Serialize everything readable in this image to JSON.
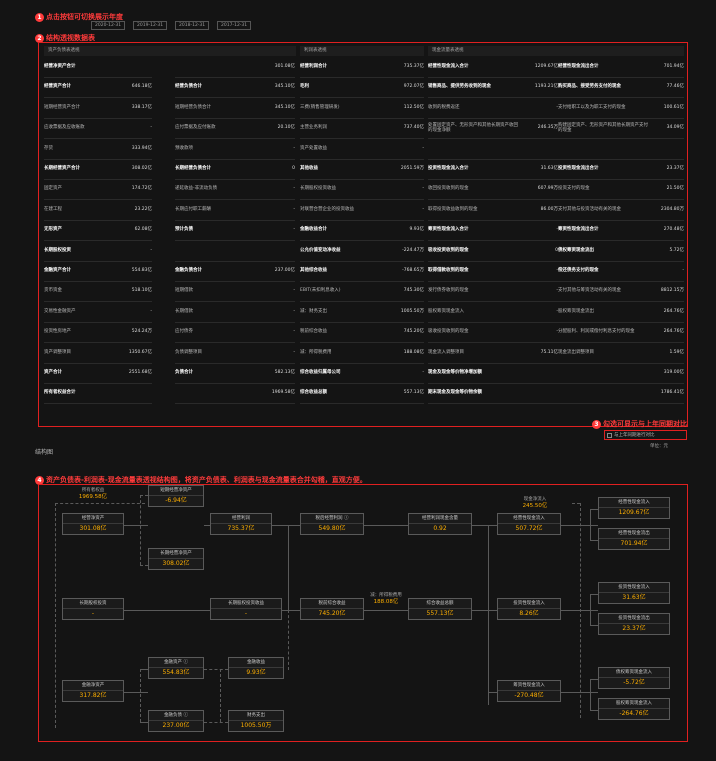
{
  "annotations": {
    "a1": {
      "num": "1",
      "text": "点击按钮可切换展示年度"
    },
    "a2": {
      "num": "2",
      "text": "结构透视数据表"
    },
    "a3": {
      "num": "3",
      "text": "勾选可显示与上年同期对比"
    },
    "a4": {
      "num": "4",
      "text": "资产负债表-利润表-现金流量表透视结构图，将资产负债表、利润表与现金流量表合并勾稽，直观方便。"
    }
  },
  "year_tabs": [
    "2020-12-31",
    "2019-12-31",
    "2018-12-31",
    "2017-12-31"
  ],
  "table": {
    "headers": {
      "bs": "资产负债表透视",
      "is": "利润表透视",
      "cf": "现金流量表透视"
    },
    "rows": [
      [
        "经营净资产合计",
        "",
        "",
        "301.08亿",
        "经营利润合计",
        "735.37亿",
        "经营性现金流入合计",
        "1209.67亿",
        "经营性现金流出合计",
        "701.94亿"
      ],
      [
        "经营资产合计",
        "646.18亿",
        "经营负债合计",
        "345.10亿",
        "毛利",
        "972.07亿",
        "销售商品、提供劳务收到的现金",
        "1193.21亿",
        "购买商品、接受劳务支付的现金",
        "77.46亿"
      ],
      [
        "短期经营资产合计",
        "338.17亿",
        "短期经营负债合计",
        "345.10亿",
        "三费(销售管理研发)",
        "112.50亿",
        "收到的税费返还",
        "-",
        "支付给职工以及为职工支付的现金",
        "100.61亿"
      ],
      [
        "应收票据及应收账款",
        "-",
        "应付票据及应付账款",
        "20.10亿",
        "主营业务利润",
        "737.40亿",
        "处置固定资产、无形资产和其他长期资产收回的现金净额",
        "246.35万",
        "购建固定资产、无形资产和其他长期资产支付的现金",
        "34.09亿"
      ],
      [
        "存货",
        "333.94亿",
        "预收款项",
        "-",
        "资产处置收益",
        "-",
        "",
        "",
        "",
        ""
      ],
      [
        "长期经营资产合计",
        "308.02亿",
        "长期经营负债合计",
        "0",
        "其他收益",
        "2051.59万",
        "投资性现金流入合计",
        "31.63亿",
        "投资性现金流出合计",
        "23.37亿"
      ],
      [
        "固定资产",
        "174.72亿",
        "递延收益-非流动负债",
        "-",
        "长期股权投资收益",
        "-",
        "收回投资收到的现金",
        "607.99万",
        "投资支付的现金",
        "21.50亿"
      ],
      [
        "在建工程",
        "23.22亿",
        "长期应付职工薪酬",
        "-",
        "对联营合营企业的投资收益",
        "-",
        "取得投资收益收到的现金",
        "86.00万",
        "支付其他与投资活动有关的现金",
        "2304.80万"
      ],
      [
        "无形资产",
        "62.08亿",
        "预计负债",
        "-",
        "金融收益合计",
        "9.93亿",
        "筹资性现金流入合计",
        "-",
        "筹资性现金流出合计",
        "270.48亿"
      ],
      [
        "长期股权投资",
        "-",
        "",
        "",
        "公允价值变动净收益",
        "-224.47万",
        "吸收投资收到的现金",
        "0",
        "债权筹资现金流出",
        "5.72亿"
      ],
      [
        "金融资产合计",
        "554.83亿",
        "金融负债合计",
        "237.00亿",
        "其他综合收益",
        "-768.65万",
        "取得借款收到的现金",
        "-",
        "偿还债务支付的现金",
        "-"
      ],
      [
        "货币资金",
        "518.10亿",
        "短期借款",
        "-",
        "EBIT(未扣利息收入)",
        "745.30亿",
        "发行债券收到的现金",
        "-",
        "支付其他与筹资活动有关的现金",
        "8812.15万"
      ],
      [
        "交易性金融资产",
        "-",
        "长期借款",
        "-",
        "减：财务支出",
        "1005.50万",
        "股权筹资现金流入",
        "-",
        "股权筹资现金流出",
        "264.76亿"
      ],
      [
        "投资性房地产",
        "524.24万",
        "应付债券",
        "-",
        "税前综合收益",
        "745.20亿",
        "吸收投资收到的现金",
        "-",
        "分配股利、利润或偿付利息支付的现金",
        "264.76亿"
      ],
      [
        "资产调整项目",
        "1350.67亿",
        "负债调整项目",
        "-",
        "减：所得税费用",
        "188.08亿",
        "现金流入调整项目",
        "75.11亿",
        "现金流出调整项目",
        "1.59亿"
      ],
      [
        "资产合计",
        "2551.68亿",
        "负债合计",
        "582.13亿",
        "综合收益归属母公司",
        "-",
        "现金及现金等价物净增加额",
        "",
        "",
        "319.00亿"
      ],
      [
        "所有者权益合计",
        "",
        "",
        "1969.58亿",
        "综合收益总额",
        "557.13亿",
        "期末现金及现金等价物余额",
        "",
        "",
        "1786.41亿"
      ]
    ]
  },
  "structure": {
    "title": "结构图",
    "compare_label": "与上年同期进行对比",
    "unit": "单位：元",
    "nodes": {
      "equity": {
        "t": "所有者权益",
        "v": "1969.58亿"
      },
      "st_op_net": {
        "t": "短期经营净资产",
        "v": "-6.94亿"
      },
      "op_net": {
        "t": "经营净资产",
        "v": "301.08亿"
      },
      "lt_op_net": {
        "t": "长期经营净资产",
        "v": "308.02亿"
      },
      "op_profit": {
        "t": "经营利润",
        "v": "735.37亿"
      },
      "pretax_op": {
        "t": "税后经营利润 ⓘ",
        "v": "549.80亿"
      },
      "op_cf_net": {
        "t": "经营利润现金含量",
        "v": "0.92"
      },
      "net_cf": {
        "t": "现金净流入",
        "v": "245.50亿"
      },
      "op_cf_in_net": {
        "t": "经营性现金流入",
        "v": "507.72亿"
      },
      "op_in": {
        "t": "经营性现金流入",
        "v": "1209.67亿"
      },
      "op_out": {
        "t": "经营性现金流出",
        "v": "701.94亿"
      },
      "lt_equity_inv": {
        "t": "长期股权投资",
        "v": "-"
      },
      "lt_equity_inc": {
        "t": "长期股权投资收益",
        "v": "-"
      },
      "pretax_comp": {
        "t": "税前综合收益",
        "v": "745.20亿"
      },
      "tax_note": {
        "t": "减：所得税费用",
        "v": "188.08亿"
      },
      "comp_total": {
        "t": "综合收益总额",
        "v": "557.13亿"
      },
      "inv_cf_net": {
        "t": "投资性现金流入",
        "v": "8.26亿"
      },
      "inv_in": {
        "t": "投资性现金流入",
        "v": "31.63亿"
      },
      "inv_out": {
        "t": "投资性现金流出",
        "v": "23.37亿"
      },
      "fin_asset": {
        "t": "金融资产 ⓘ",
        "v": "554.83亿"
      },
      "fin_inc": {
        "t": "金融收益",
        "v": "9.93亿"
      },
      "fin_net": {
        "t": "金融净资产",
        "v": "317.82亿"
      },
      "fin_liab": {
        "t": "金融负债 ⓘ",
        "v": "237.00亿"
      },
      "fin_exp": {
        "t": "财务支出",
        "v": "1005.50万"
      },
      "fund_cf_net": {
        "t": "筹资性现金流入",
        "v": "-270.48亿"
      },
      "debt_cf": {
        "t": "债权筹资现金流入",
        "v": "-5.72亿"
      },
      "eq_cf": {
        "t": "股权筹资现金流入",
        "v": "-264.76亿"
      }
    }
  }
}
